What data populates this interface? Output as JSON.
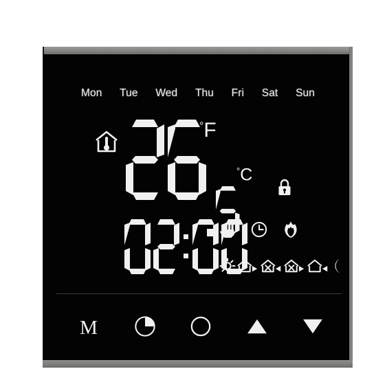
{
  "device": {
    "type": "programmable-room-thermostat",
    "screen_background": "#030303",
    "segment_color": "#f0f0f0",
    "bezel_color": "#848482"
  },
  "weekdays": {
    "items": [
      {
        "label": "Mon",
        "active": true
      },
      {
        "label": "Tue",
        "active": true
      },
      {
        "label": "Wed",
        "active": true
      },
      {
        "label": "Thu",
        "active": true
      },
      {
        "label": "Fri",
        "active": true
      },
      {
        "label": "Sat",
        "active": true
      },
      {
        "label": "Sun",
        "active": true
      }
    ]
  },
  "temperature": {
    "integer_part": "26",
    "decimal_separator": ".",
    "fraction_part": "5",
    "value": "26.5",
    "unit_fahrenheit": "F",
    "unit_celsius": "C",
    "degree_symbol": "°",
    "room_icon_name": "house-thermometer-icon",
    "lock_icon_name": "padlock-icon"
  },
  "clock": {
    "hours": "02",
    "minutes": "00",
    "separator": ":",
    "value": "02:00"
  },
  "status": {
    "icons": [
      {
        "name": "hand-icon",
        "label": "Manual mode"
      },
      {
        "name": "clock-icon",
        "label": "Programmed / auto mode"
      },
      {
        "name": "flame-icon",
        "label": "Heating active"
      }
    ]
  },
  "schedule": {
    "periods": [
      {
        "name": "sun-icon",
        "label": "Wake"
      },
      {
        "name": "house-arrow-out-icon",
        "label": "Leave"
      },
      {
        "name": "house-meal-arrow-in-icon",
        "label": "Return for lunch"
      },
      {
        "name": "house-meal-arrow-out-icon",
        "label": "Leave after lunch"
      },
      {
        "name": "house-arrow-in-icon",
        "label": "Return home"
      },
      {
        "name": "moon-icon",
        "label": "Sleep"
      }
    ]
  },
  "buttons": [
    {
      "name": "mode-button",
      "label": "M",
      "icon": "letter-m"
    },
    {
      "name": "timer-button",
      "label": "",
      "icon": "clock-pie-icon"
    },
    {
      "name": "power-button",
      "label": "",
      "icon": "power-circle-icon"
    },
    {
      "name": "temp-up-button",
      "label": "",
      "icon": "triangle-up-icon"
    },
    {
      "name": "temp-down-button",
      "label": "",
      "icon": "triangle-down-icon"
    }
  ]
}
